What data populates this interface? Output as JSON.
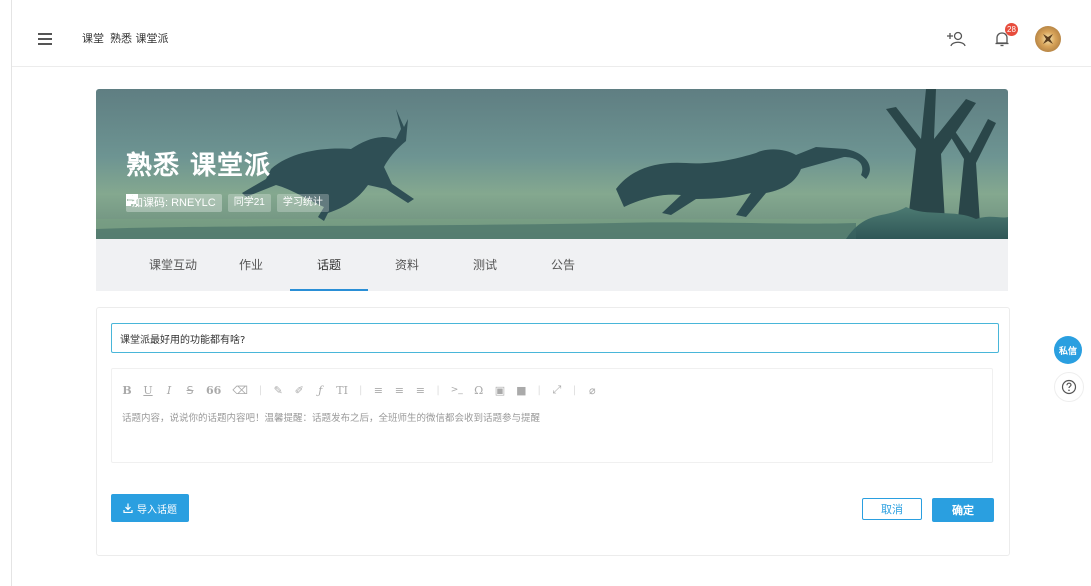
{
  "breadcrumb": {
    "root": "课堂",
    "course": "熟悉 课堂派"
  },
  "header": {
    "notification_count": "28",
    "icons": [
      "menu-icon",
      "add-user-icon",
      "bell-icon",
      "avatar"
    ]
  },
  "course": {
    "title": "熟悉 课堂派",
    "join_code_label": "加课码: RNEYLC",
    "students_label": "同学21",
    "stats_label": "学习统计"
  },
  "tabs": [
    {
      "label": "课堂互动"
    },
    {
      "label": "作业"
    },
    {
      "label": "话题",
      "active": true
    },
    {
      "label": "资料"
    },
    {
      "label": "测试"
    },
    {
      "label": "公告"
    }
  ],
  "topic_form": {
    "title_value": "课堂派最好用的功能都有啥?",
    "content_placeholder": "话题内容，说说你的话题内容吧！温馨提醒：话题发布之后，全班师生的微信都会收到话题参与提醒",
    "toolbar": {
      "bold": "B",
      "underline": "U",
      "italic": "I",
      "strike": "S",
      "quote": "66",
      "text_size": "TI",
      "code": ">_",
      "omega": "Ω"
    },
    "import_label": "导入话题",
    "cancel_label": "取消",
    "confirm_label": "确定"
  },
  "side": {
    "private_message_label": "私信"
  },
  "colors": {
    "accent": "#2a9fe0",
    "active_tab_underline": "#2a8fd6",
    "badge": "#e74c3c",
    "input_border": "#49b6d9"
  }
}
